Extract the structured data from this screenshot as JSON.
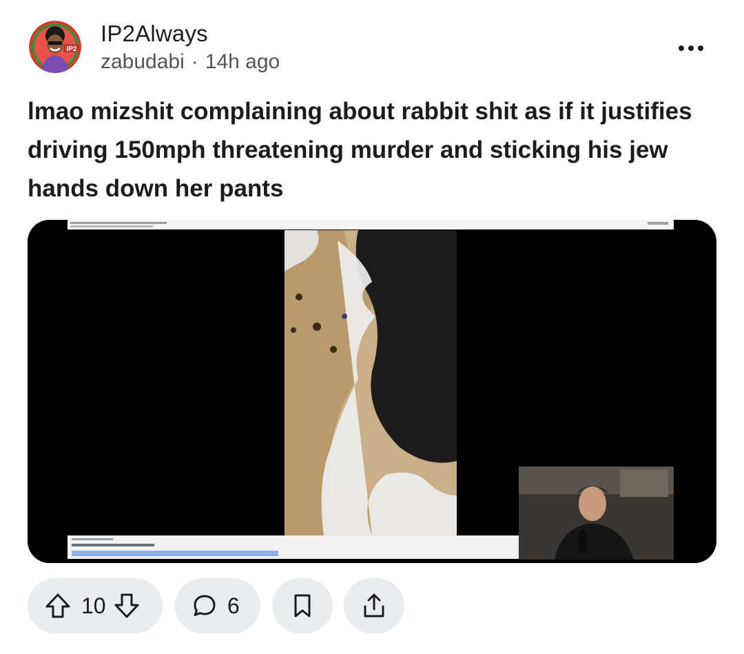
{
  "post": {
    "community": "IP2Always",
    "author": "zabudabi",
    "separator": "·",
    "time_ago": "14h ago",
    "title_lines": [
      "lmao mizshit complaining about rabbit shit as if it justifies",
      "driving 150mph threatening murder and sticking his jew",
      "hands down her pants"
    ],
    "avatar_badge": "IP2"
  },
  "actions": {
    "vote_count": "10",
    "comment_count": "6"
  },
  "icons": {
    "more": "more-horizontal-icon",
    "upvote": "arrow-up-icon",
    "downvote": "arrow-down-icon",
    "comment": "speech-bubble-icon",
    "save": "bookmark-icon",
    "share": "share-icon"
  },
  "colors": {
    "pill_bg": "#eaedef",
    "text": "#1c1c1c",
    "meta": "#545454"
  }
}
